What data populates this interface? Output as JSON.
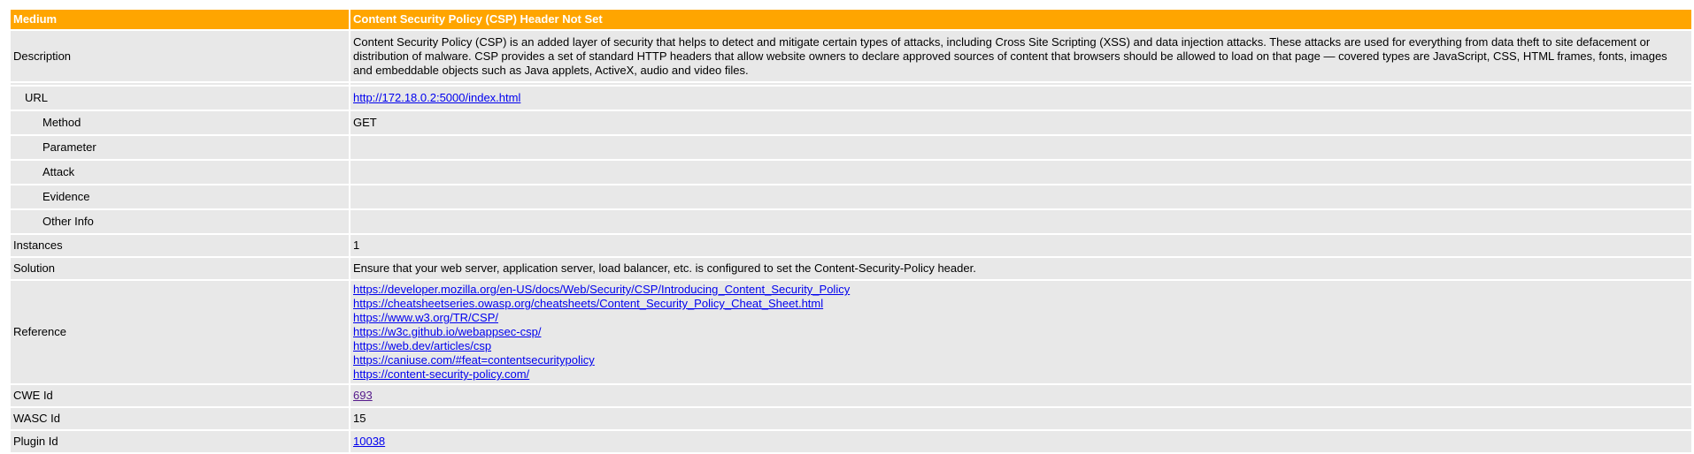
{
  "alert": {
    "risk": "Medium",
    "name": "Content Security Policy (CSP) Header Not Set",
    "colors": {
      "header_bg": "#ffa500",
      "header_text": "#ffffff",
      "cell_bg": "#e8e8e8",
      "link": "#0000ee",
      "visited_link": "#551a8b"
    },
    "description_label": "Description",
    "description": "Content Security Policy (CSP) is an added layer of security that helps to detect and mitigate certain types of attacks, including Cross Site Scripting (XSS) and data injection attacks. These attacks are used for everything from data theft to site defacement or distribution of malware. CSP provides a set of standard HTTP headers that allow website owners to declare approved sources of content that browsers should be allowed to load on that page — covered types are JavaScript, CSS, HTML frames, fonts, images and embeddable objects such as Java applets, ActiveX, audio and video files.",
    "url_label": "URL",
    "url": "http://172.18.0.2:5000/index.html",
    "method_label": "Method",
    "method": "GET",
    "parameter_label": "Parameter",
    "parameter": "",
    "attack_label": "Attack",
    "attack": "",
    "evidence_label": "Evidence",
    "evidence": "",
    "other_info_label": "Other Info",
    "other_info": "",
    "instances_label": "Instances",
    "instances": "1",
    "solution_label": "Solution",
    "solution": "Ensure that your web server, application server, load balancer, etc. is configured to set the Content-Security-Policy header.",
    "reference_label": "Reference",
    "references": [
      "https://developer.mozilla.org/en-US/docs/Web/Security/CSP/Introducing_Content_Security_Policy",
      "https://cheatsheetseries.owasp.org/cheatsheets/Content_Security_Policy_Cheat_Sheet.html",
      "https://www.w3.org/TR/CSP/",
      "https://w3c.github.io/webappsec-csp/",
      "https://web.dev/articles/csp",
      "https://caniuse.com/#feat=contentsecuritypolicy",
      "https://content-security-policy.com/"
    ],
    "cwe_label": "CWE Id",
    "cwe_id": "693",
    "wasc_label": "WASC Id",
    "wasc_id": "15",
    "plugin_label": "Plugin Id",
    "plugin_id": "10038"
  }
}
